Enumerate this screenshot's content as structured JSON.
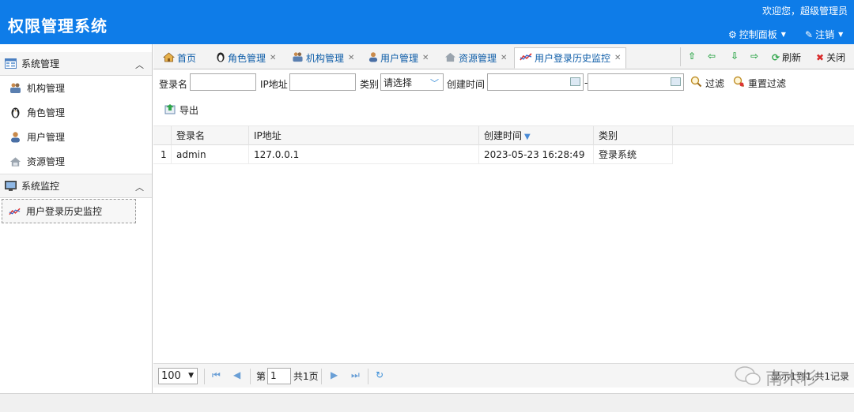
{
  "header": {
    "app_title": "权限管理系统",
    "welcome": "欢迎您，超级管理员",
    "control_panel": "控制面板",
    "logout": "注销"
  },
  "sidebar": {
    "groups": [
      {
        "title": "系统管理",
        "items": [
          {
            "label": "机构管理",
            "icon": "org-icon"
          },
          {
            "label": "角色管理",
            "icon": "penguin-icon"
          },
          {
            "label": "用户管理",
            "icon": "user-icon"
          },
          {
            "label": "资源管理",
            "icon": "resource-icon"
          }
        ]
      },
      {
        "title": "系统监控",
        "items": [
          {
            "label": "用户登录历史监控",
            "icon": "chart-line-icon",
            "active": true
          }
        ]
      }
    ]
  },
  "tabs": [
    {
      "label": "首页",
      "closable": false
    },
    {
      "label": "角色管理",
      "closable": true
    },
    {
      "label": "机构管理",
      "closable": true
    },
    {
      "label": "用户管理",
      "closable": true
    },
    {
      "label": "资源管理",
      "closable": true
    },
    {
      "label": "用户登录历史监控",
      "closable": true,
      "active": true
    }
  ],
  "tab_tools": {
    "refresh": "刷新",
    "close": "关闭"
  },
  "filter": {
    "login_name_label": "登录名",
    "ip_label": "IP地址",
    "category_label": "类别",
    "category_value": "请选择",
    "created_label": "创建时间",
    "date_separator": "-",
    "filter_button": "过滤",
    "reset_button": "重置过滤"
  },
  "toolbar": {
    "export": "导出"
  },
  "grid": {
    "columns": [
      "登录名",
      "IP地址",
      "创建时间",
      "类别"
    ],
    "sorted_column": "创建时间",
    "rows": [
      {
        "index": "1",
        "login_name": "admin",
        "ip": "127.0.0.1",
        "created": "2023-05-23 16:28:49",
        "category": "登录系统"
      }
    ]
  },
  "pager": {
    "page_size": "100",
    "page_prefix": "第",
    "page_value": "1",
    "page_total": "共1页",
    "record_info": "显示1到1,共1记录"
  },
  "watermark": {
    "text": "南木杉"
  },
  "colors": {
    "header_bg": "#0e7ce8",
    "link": "#0e5da8"
  }
}
